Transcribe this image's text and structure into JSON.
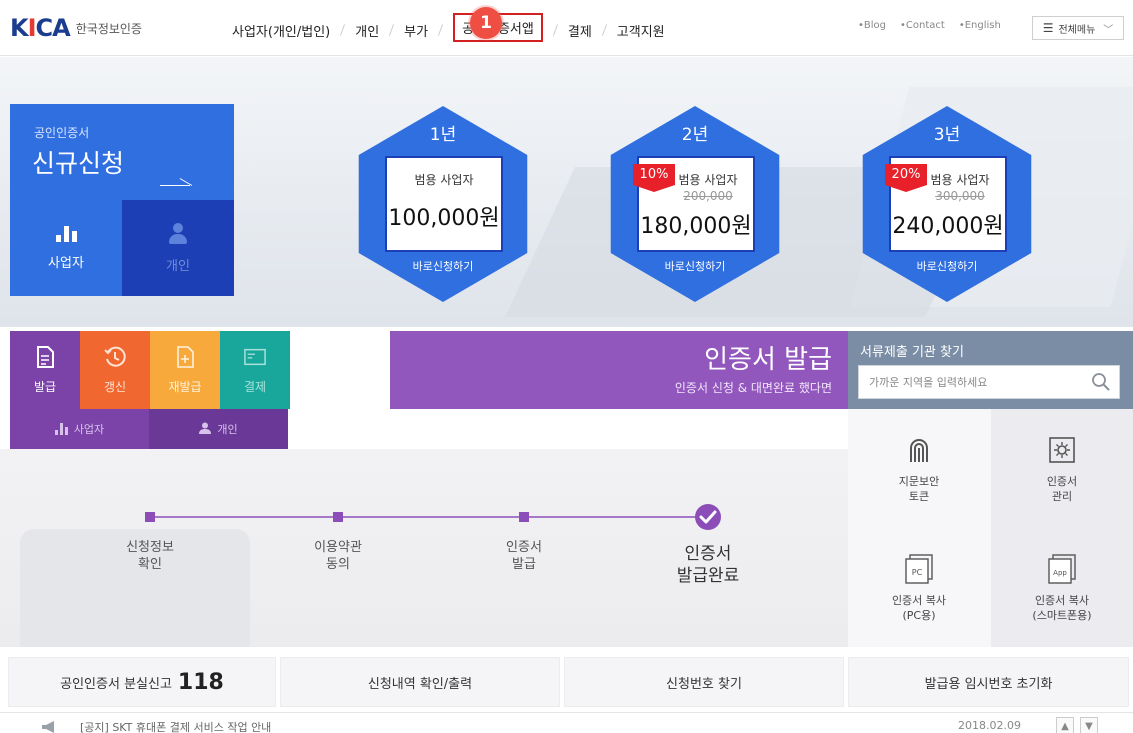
{
  "brand": {
    "logo_text": "KICA",
    "name": "한국정보인증"
  },
  "nav": {
    "items": [
      {
        "label": "사업자(개인/법인)"
      },
      {
        "label": "개인"
      },
      {
        "label": "부가"
      },
      {
        "label": "공인인증서앱"
      },
      {
        "label": "결제"
      },
      {
        "label": "고객지원"
      }
    ],
    "step_badge": "1",
    "utils": [
      "•Blog",
      "•Contact",
      "•English"
    ],
    "all_menu": "전체메뉴"
  },
  "new_application": {
    "subtitle": "공인인증서",
    "title": "신규신청",
    "business_label": "사업자",
    "individual_label": "개인"
  },
  "plans": [
    {
      "period": "1년",
      "plan": "범용 사업자",
      "original_price": "",
      "price": "100,000원",
      "discount": "",
      "cta": "바로신청하기"
    },
    {
      "period": "2년",
      "plan": "범용 사업자",
      "original_price": "200,000",
      "price": "180,000원",
      "discount": "10%",
      "cta": "바로신청하기"
    },
    {
      "period": "3년",
      "plan": "범용 사업자",
      "original_price": "300,000",
      "price": "240,000원",
      "discount": "20%",
      "cta": "바로신청하기"
    }
  ],
  "services": {
    "issue": "발급",
    "renew": "갱신",
    "reissue": "재발급",
    "payment": "결제"
  },
  "cert_banner": {
    "title": "인증서 발급",
    "subtitle": "인증서 신청 & 대면완료 했다면"
  },
  "subtabs": {
    "business": "사업자",
    "individual": "개인"
  },
  "steps": [
    {
      "label": "신청정보\n확인"
    },
    {
      "label": "이용약관\n동의"
    },
    {
      "label": "인증서\n발급"
    },
    {
      "label": "인증서\n발급완료"
    }
  ],
  "finder": {
    "title": "서류제출 기관 찾기",
    "placeholder": "가까운 지역을 입력하세요"
  },
  "tools": [
    {
      "icon": "fingerprint-icon",
      "label": "지문보안\n토큰"
    },
    {
      "icon": "gear-icon",
      "label": "인증서\n관리"
    },
    {
      "icon": "pc-icon",
      "label": "인증서 복사\n(PC용)"
    },
    {
      "icon": "app-icon",
      "label": "인증서 복사\n(스마트폰용)"
    }
  ],
  "bottom_links": {
    "loss_report": "공인인증서 분실신고",
    "loss_number": "118",
    "history": "신청내역 확인/출력",
    "find_number": "신청번호 찾기",
    "reset_temp": "발급용 임시번호 초기화"
  },
  "notice": {
    "text": "[공지] SKT 휴대폰 결제 서비스 작업 안내",
    "date": "2018.02.09"
  },
  "colors": {
    "primary_blue": "#2f6fe0",
    "dark_blue": "#1d3fb5",
    "purple": "#7b43a8",
    "orange": "#f0682f",
    "amber": "#f7a93b",
    "teal": "#1aa79b",
    "badge_red": "#e8202a",
    "highlight_red": "#d32020"
  }
}
